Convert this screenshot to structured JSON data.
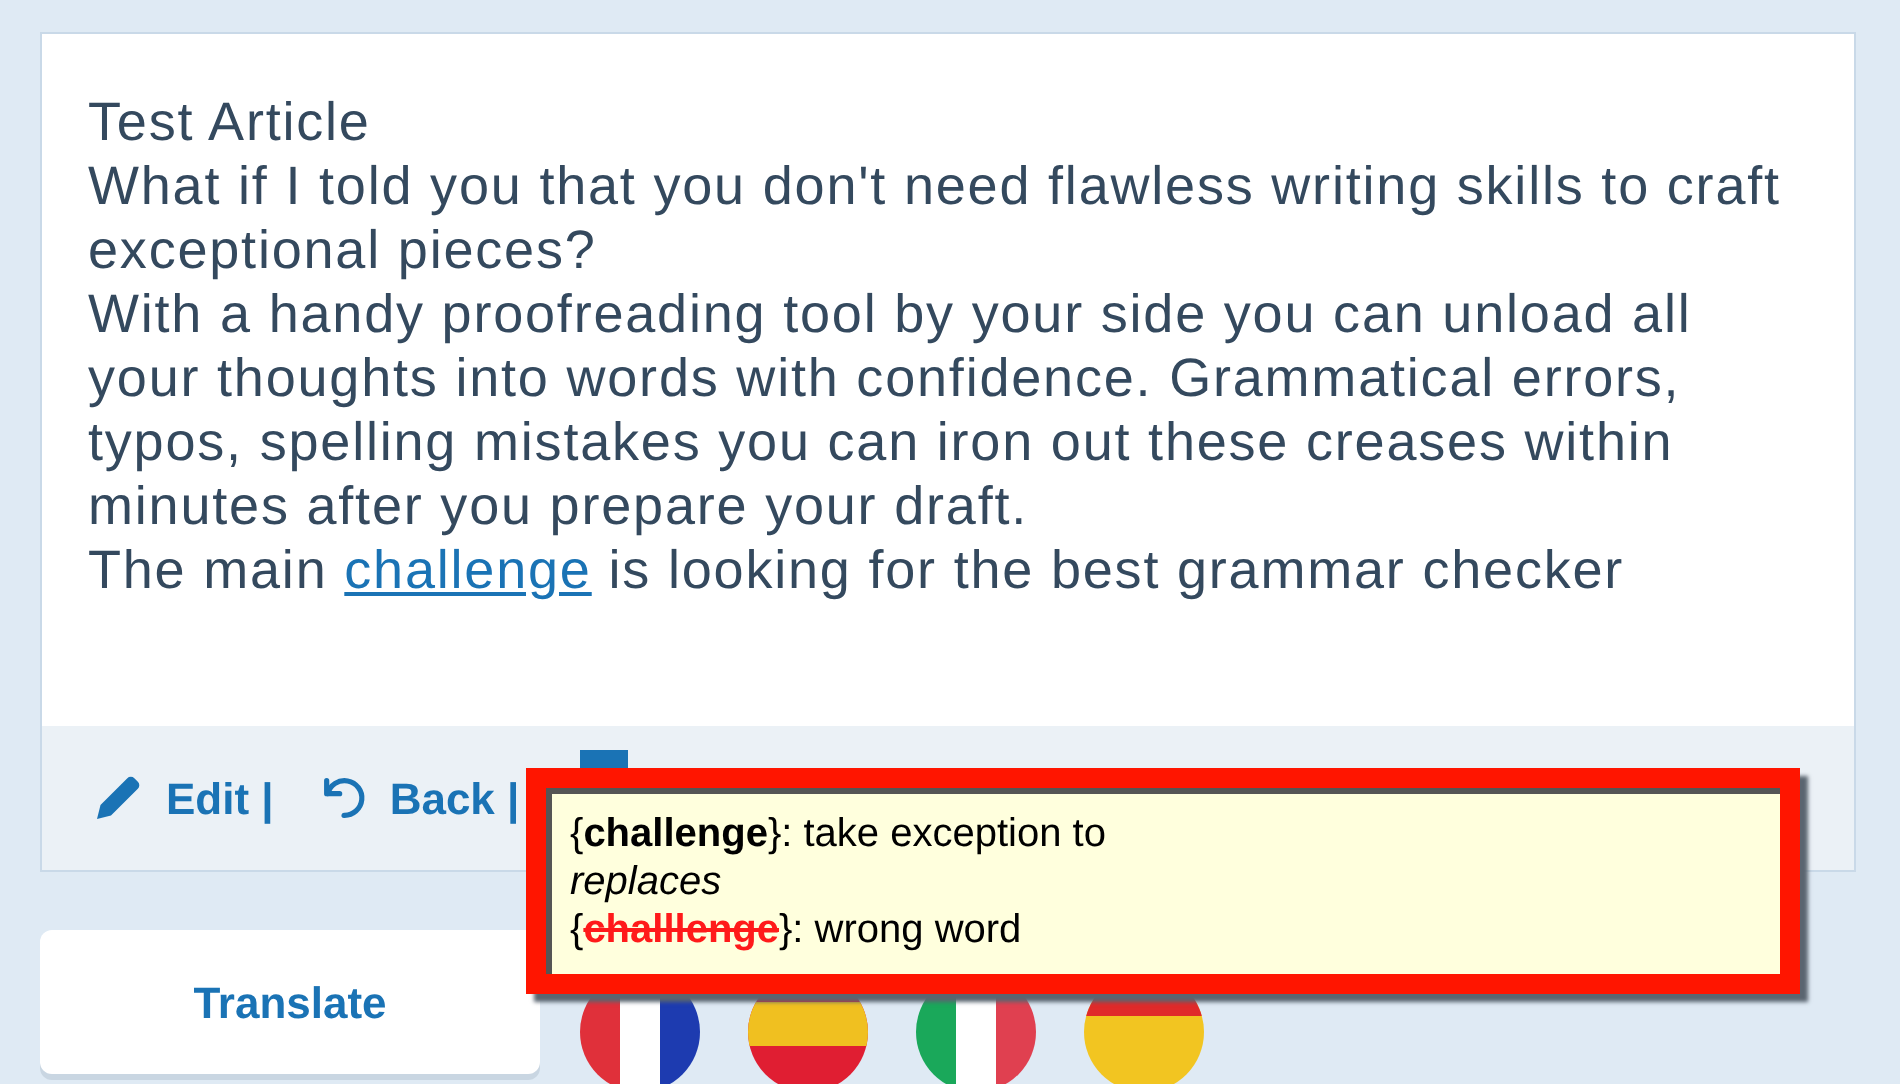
{
  "article": {
    "title": "Test Article",
    "paragraphs": [
      {
        "text": "What if I told you that you don't need flawless writing skills to craft exceptional pieces?"
      },
      {
        "text": "With a handy proofreading tool by your side you can unload all your thoughts into words with confidence. Grammatical errors, typos, spelling mistakes you can iron out these creases within minutes after you prepare your draft."
      },
      {
        "before": "The main ",
        "link": "challenge",
        "after": " is looking for the best grammar checker"
      }
    ]
  },
  "toolbar": [
    {
      "kind": "edit",
      "label": "Edit |"
    },
    {
      "kind": "back",
      "label": "Back |"
    }
  ],
  "tooltip": {
    "lines": [
      {
        "kind": "meaning",
        "text": "{**challenge**}: take exception to"
      },
      {
        "kind": "heading",
        "text": "replaces"
      },
      {
        "kind": "replaced",
        "open": "{",
        "word": "challlenge",
        "rest": "}: wrong word"
      }
    ]
  },
  "translate_button": "Translate"
}
